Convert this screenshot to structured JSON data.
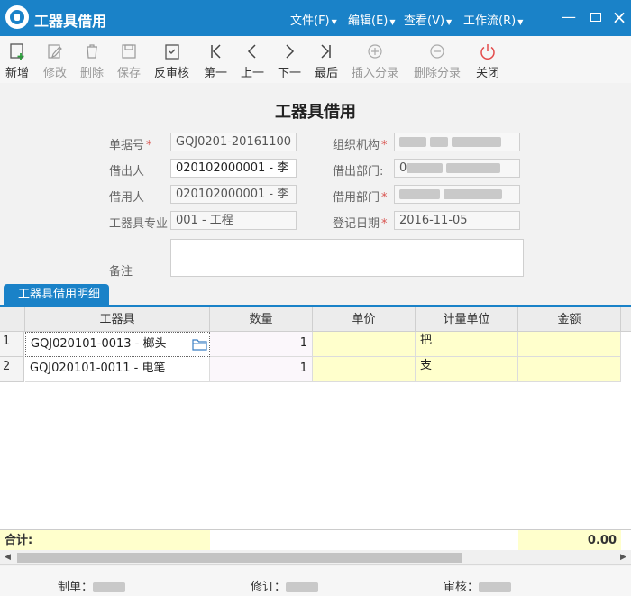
{
  "window": {
    "title": "工器具借用",
    "menus": [
      "文件(F)",
      "编辑(E)",
      "查看(V)",
      "工作流(R)"
    ],
    "controls": {
      "minimize": "minimize-icon",
      "maximize": "maximize-icon",
      "close": "close-icon"
    }
  },
  "toolbar": {
    "new": "新增",
    "edit": "修改",
    "delete": "删除",
    "save": "保存",
    "unaudit": "反审核",
    "first": "第一",
    "prev": "上一",
    "next": "下一",
    "last": "最后",
    "insert_entry": "插入分录",
    "delete_entry": "删除分录",
    "close": "关闭"
  },
  "form": {
    "heading": "工器具借用",
    "doc_no_label": "单据号",
    "doc_no": "GQJ0201-20161100",
    "org_label": "组织机构",
    "lender_label": "借出人",
    "lender": "020102000001 - 李",
    "lend_dept_label": "借出部门:",
    "lend_dept_prefix": "0",
    "borrower_label": "借用人",
    "borrower": "020102000001 - 李",
    "borrow_dept_label": "借用部门",
    "specialty_label": "工器具专业",
    "specialty": "001 - 工程",
    "reg_date_label": "登记日期",
    "reg_date": "2016-11-05",
    "remark_label": "备注",
    "remark": ""
  },
  "detail": {
    "tab": "工器具借用明细",
    "columns": [
      "工器具",
      "数量",
      "单价",
      "计量单位",
      "金额"
    ],
    "rows": [
      {
        "no": "1",
        "tool": "GQJ020101-0013 - 榔头",
        "qty": "1",
        "price": "",
        "unit": "把",
        "amount": ""
      },
      {
        "no": "2",
        "tool": "GQJ020101-0011 - 电笔",
        "qty": "1",
        "price": "",
        "unit": "支",
        "amount": ""
      }
    ],
    "total_label": "合计:",
    "total_amount": "0.00"
  },
  "footer": {
    "maker_label": "制单：",
    "revise_label": "修订：",
    "audit_label": "审核："
  },
  "colors": {
    "accent": "#1a82c8",
    "required": "#d9534f",
    "editable_cell": "#ffffcc",
    "close_icon": "#e34b4b"
  }
}
